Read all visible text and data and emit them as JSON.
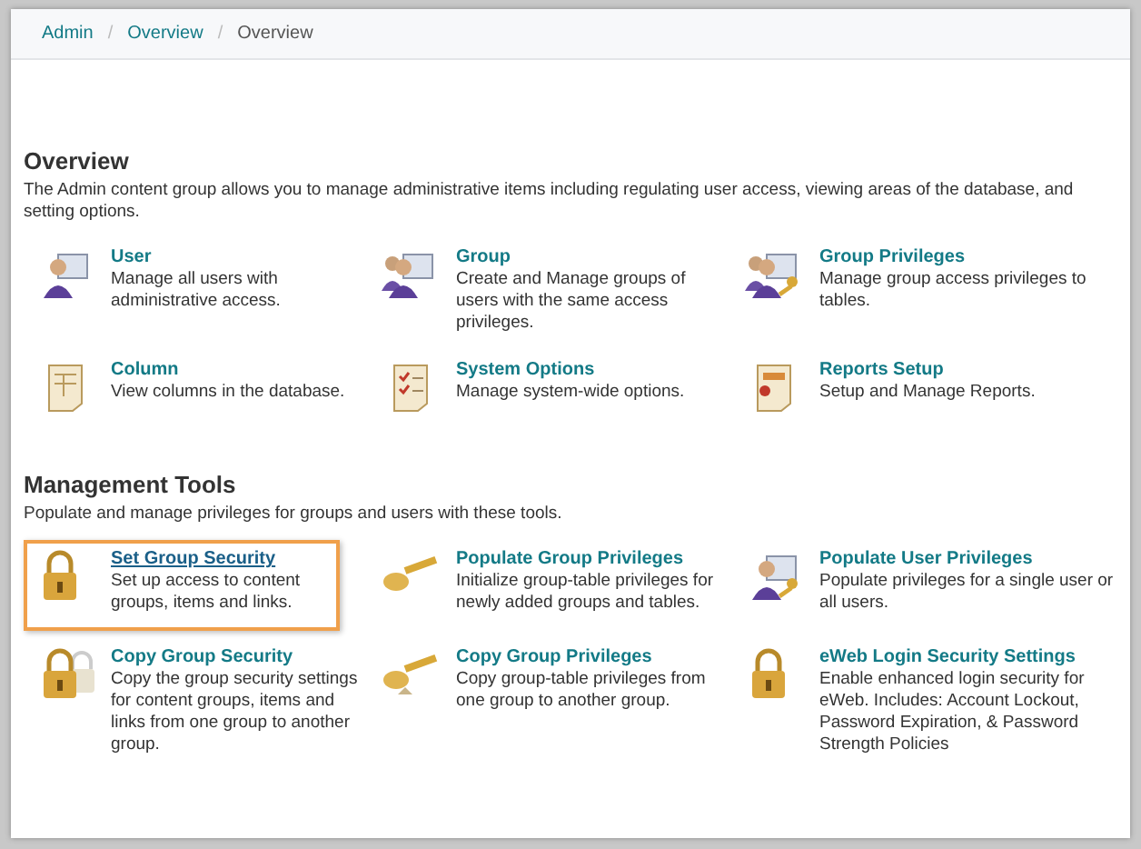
{
  "breadcrumb": [
    {
      "label": "Admin",
      "link": true
    },
    {
      "separator": "/"
    },
    {
      "label": "Overview",
      "link": true
    },
    {
      "separator": "/"
    },
    {
      "label": "Overview",
      "link": false
    }
  ],
  "sections": [
    {
      "title": "Overview",
      "description": "The Admin content group allows you to manage administrative items including regulating user access, viewing areas of the database, and setting options.",
      "items": [
        {
          "title": "User",
          "description": "Manage all users with administrative access.",
          "selected": false
        },
        {
          "title": "Group",
          "description": "Create and Manage groups of users with the same access privileges.",
          "selected": false
        },
        {
          "title": "Group Privileges",
          "description": "Manage group access privileges to tables.",
          "selected": false
        },
        {
          "title": "Column",
          "description": "View columns in the database.",
          "selected": false
        },
        {
          "title": "System Options",
          "description": "Manage system-wide options.",
          "selected": false
        },
        {
          "title": "Reports Setup",
          "description": "Setup and Manage Reports.",
          "selected": false
        }
      ]
    },
    {
      "title": "Management Tools",
      "description": "Populate and manage privileges for groups and users with these tools.",
      "items": [
        {
          "title": "Set Group Security",
          "description": "Set up access to content groups, items and links.",
          "selected": true
        },
        {
          "title": "Populate Group Privileges",
          "description": "Initialize group-table privileges for newly added groups and tables.",
          "selected": false
        },
        {
          "title": "Populate User Privileges",
          "description": "Populate privileges for a single user or all users.",
          "selected": false
        },
        {
          "title": "Copy Group Security",
          "description": "Copy the group security settings for content groups, items and links from one group to another group.",
          "selected": false
        },
        {
          "title": "Copy Group Privileges",
          "description": "Copy group-table privileges from one group to another group.",
          "selected": false
        },
        {
          "title": "eWeb Login Security Settings",
          "description": "Enable enhanced login security for eWeb. Includes: Account Lockout, Password Expiration, & Password Strength Policies",
          "selected": false
        }
      ]
    }
  ]
}
